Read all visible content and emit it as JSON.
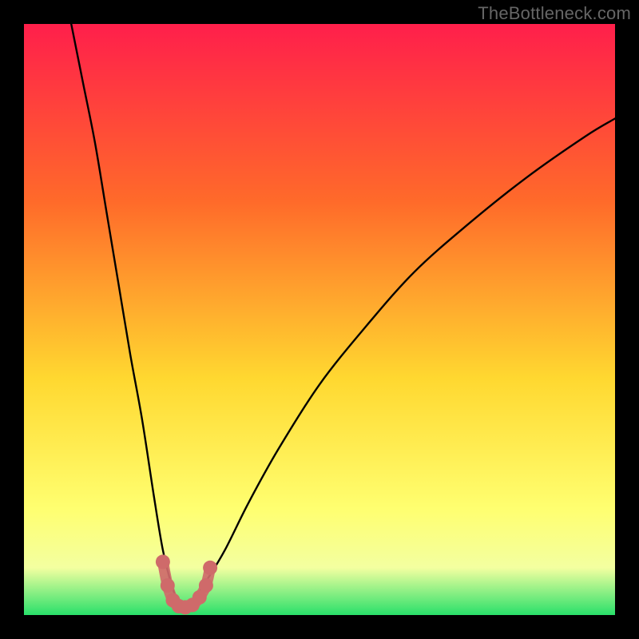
{
  "watermark": "TheBottleneck.com",
  "colors": {
    "frame": "#000000",
    "gradient_top": "#ff1f4b",
    "gradient_mid1": "#ff6a2a",
    "gradient_mid2": "#ffd830",
    "gradient_mid3": "#ffff70",
    "gradient_mid4": "#f3ffa0",
    "gradient_bottom": "#29e06a",
    "curve": "#000000",
    "marker_stroke": "#cf6a6a",
    "marker_fill": "#cf6a6a"
  },
  "chart_data": {
    "type": "line",
    "title": "",
    "xlabel": "",
    "ylabel": "",
    "xlim": [
      0,
      100
    ],
    "ylim": [
      0,
      100
    ],
    "note": "x is a normalized hardware-balance axis (0–100); y is bottleneck percentage (0 = no bottleneck). Values are read off the figure by pixel position since no axes are drawn.",
    "series": [
      {
        "name": "left-branch",
        "x": [
          8,
          10,
          12,
          14,
          16,
          18,
          20,
          22,
          23.5,
          25,
          26,
          27
        ],
        "y": [
          100,
          90,
          80,
          68,
          56,
          44,
          33,
          20,
          11,
          5,
          2.5,
          1.5
        ]
      },
      {
        "name": "right-branch",
        "x": [
          27,
          29,
          31,
          34,
          38,
          43,
          50,
          58,
          66,
          75,
          85,
          95,
          100
        ],
        "y": [
          1.5,
          3,
          6,
          11,
          19,
          28,
          39,
          49,
          58,
          66,
          74,
          81,
          84
        ]
      },
      {
        "name": "sweet-spot-markers",
        "x": [
          23.5,
          24.3,
          25.2,
          26.2,
          27.3,
          28.5,
          29.7,
          30.8,
          31.5
        ],
        "y": [
          9,
          5,
          2.5,
          1.5,
          1.3,
          1.7,
          3,
          5,
          8
        ]
      }
    ],
    "optimum_x": 27
  }
}
